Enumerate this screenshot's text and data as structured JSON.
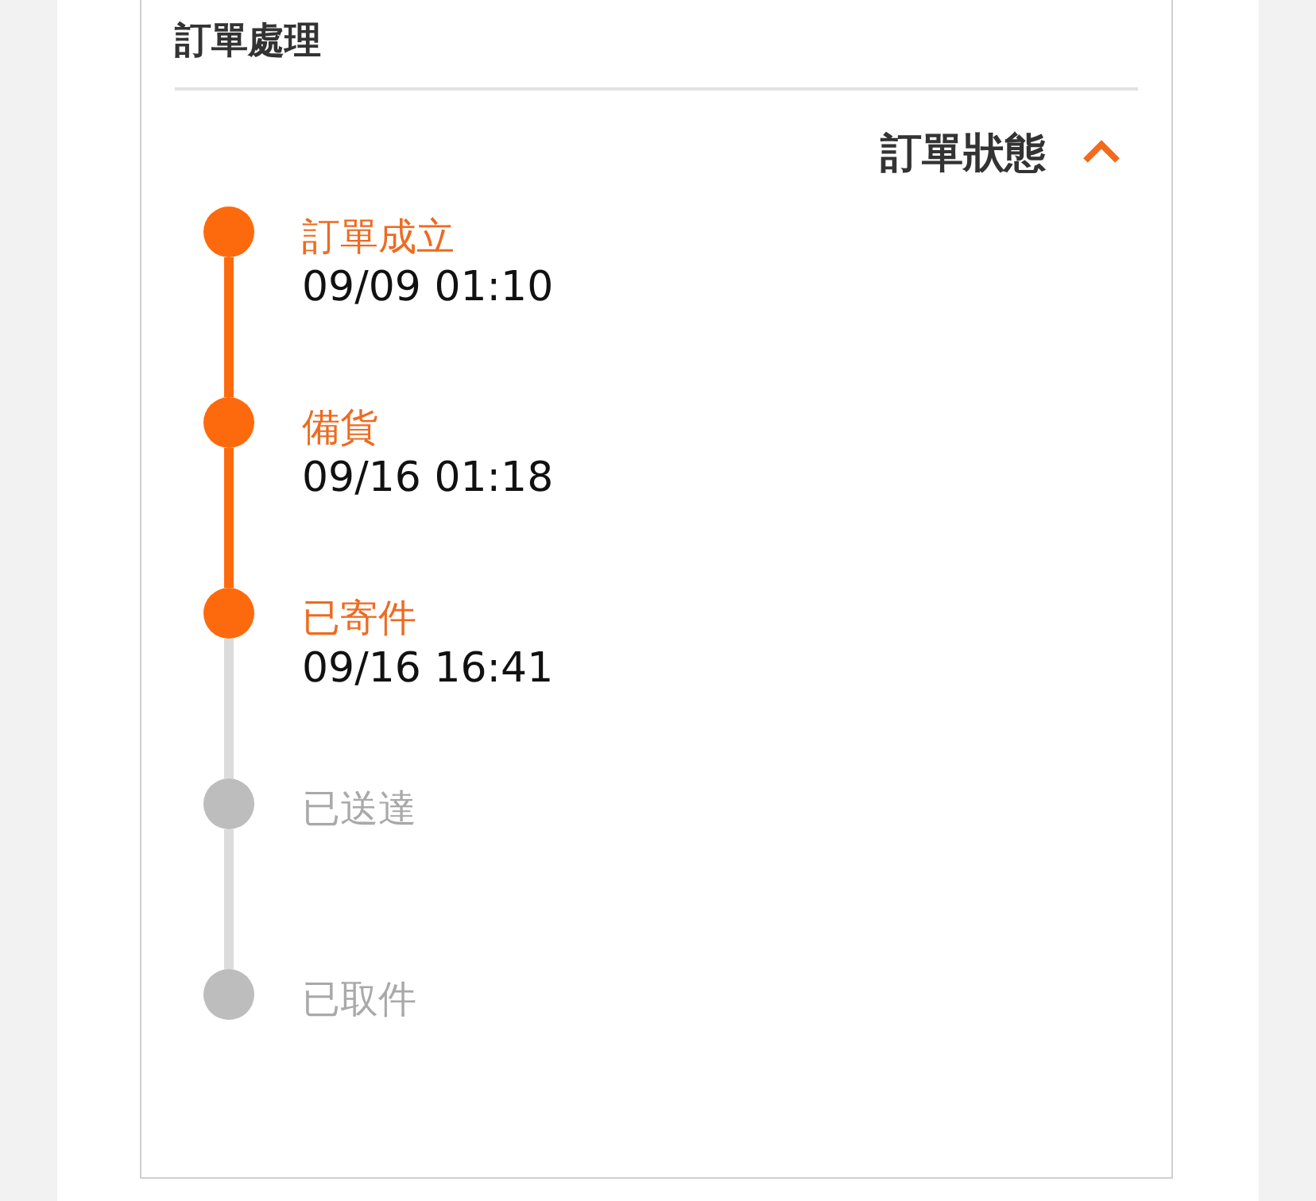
{
  "card": {
    "title": "訂單處理"
  },
  "status": {
    "title": "訂單狀態",
    "expanded": true
  },
  "steps": [
    {
      "label": "訂單成立",
      "time": "09/09 01:10",
      "done": true
    },
    {
      "label": "備貨",
      "time": "09/16 01:18",
      "done": true
    },
    {
      "label": "已寄件",
      "time": "09/16 16:41",
      "done": true
    },
    {
      "label": "已送達",
      "done": false
    },
    {
      "label": "已取件",
      "done": false
    }
  ]
}
